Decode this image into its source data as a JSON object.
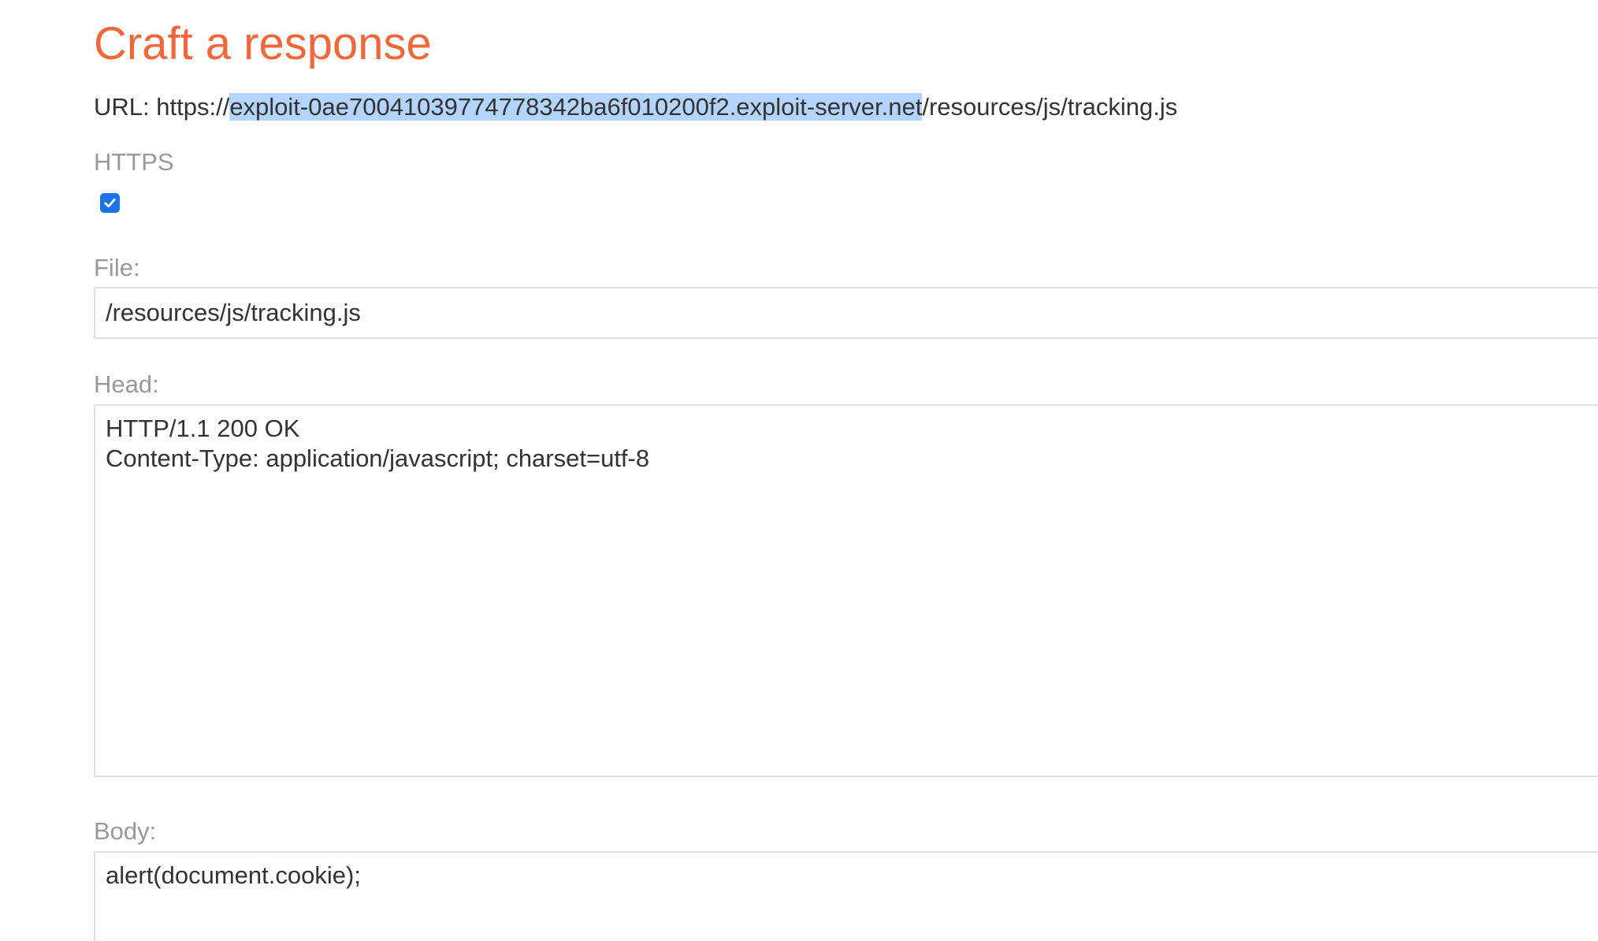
{
  "page": {
    "title": "Craft a response"
  },
  "url": {
    "label": "URL:",
    "prefix": "https://",
    "host": "exploit-0ae70041039774778342ba6f010200f2.exploit-server.net",
    "path": "/resources/js/tracking.js"
  },
  "https": {
    "label": "HTTPS",
    "checked": true
  },
  "file": {
    "label": "File:",
    "value": "/resources/js/tracking.js"
  },
  "head": {
    "label": "Head:",
    "lines": [
      "HTTP/1.1 200 OK",
      "Content-Type: application/javascript; charset=utf-8"
    ]
  },
  "body": {
    "label": "Body:",
    "lines": [
      "alert(document.cookie);"
    ]
  },
  "colors": {
    "title": "#f0683a",
    "checkbox": "#1a73e8",
    "selection": "#b3d4fc",
    "label": "#999999",
    "text": "#333333",
    "border": "#e1e1e1"
  }
}
